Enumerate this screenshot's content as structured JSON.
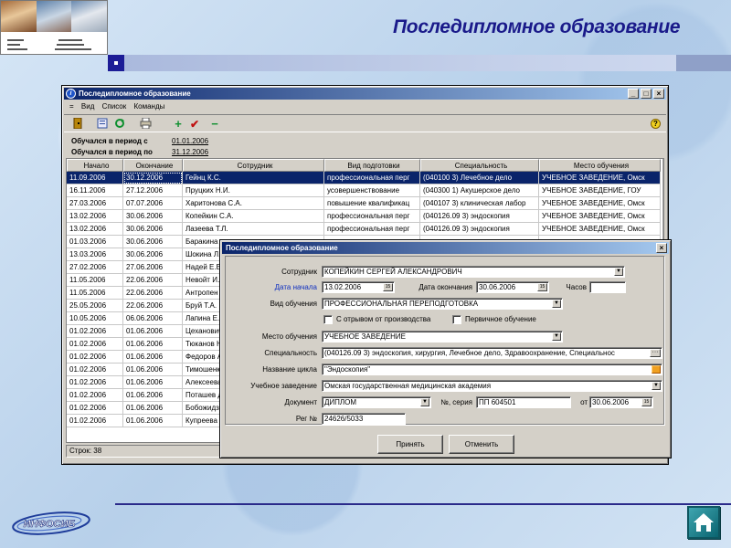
{
  "slide": {
    "title": "Последипломное образование",
    "logo_caption": "\n\n\n\n\n\n\n\n",
    "footer_logo": "ИНФОСИБ"
  },
  "main_window": {
    "title": "Последипломное образование",
    "menu": [
      "=",
      "Вид",
      "Список",
      "Команды"
    ],
    "filter_from_label": "Обучался в период с",
    "filter_from_value": "01.01.2006",
    "filter_to_label": "Обучался в период по",
    "filter_to_value": "31.12.2006",
    "columns": [
      "Начало",
      "Окончание",
      "Сотрудник",
      "Вид подготовки",
      "Специальность",
      "Место обучения"
    ],
    "rows": [
      [
        "11.09.2006",
        "30.12.2006",
        "Гейнц К.С.",
        "профессиональная перг",
        "(040100 3) Лечебное дело",
        "УЧЕБНОЕ ЗАВЕДЕНИЕ, Омск"
      ],
      [
        "16.11.2006",
        "27.12.2006",
        "Пруцких Н.И.",
        "усовершенствование",
        "(040300 1) Акушерское дело",
        "УЧЕБНОЕ ЗАВЕДЕНИЕ, ГОУ"
      ],
      [
        "27.03.2006",
        "07.07.2006",
        "Харитонова С.А.",
        "повышение квалификац",
        "(040107 3) клиническая лабор",
        "УЧЕБНОЕ ЗАВЕДЕНИЕ, Омск"
      ],
      [
        "13.02.2006",
        "30.06.2006",
        "Копейкин С.А.",
        "профессиональная перг",
        "(040126.09 3) эндоскопия",
        "УЧЕБНОЕ ЗАВЕДЕНИЕ, Омск"
      ],
      [
        "13.02.2006",
        "30.06.2006",
        "Лазеева Т.Л.",
        "профессиональная перг",
        "(040126.09 3) эндоскопия",
        "УЧЕБНОЕ ЗАВЕДЕНИЕ, Омск"
      ],
      [
        "01.03.2006",
        "30.06.2006",
        "Баракина",
        "",
        "",
        ""
      ],
      [
        "13.03.2006",
        "30.06.2006",
        "Шокина Л.",
        "",
        "",
        ""
      ],
      [
        "27.02.2006",
        "27.06.2006",
        "Надей Е.В.",
        "",
        "",
        ""
      ],
      [
        "11.05.2006",
        "22.06.2006",
        "Невойт И.",
        "",
        "",
        ""
      ],
      [
        "11.05.2006",
        "22.06.2006",
        "Антропен",
        "",
        "",
        ""
      ],
      [
        "25.05.2006",
        "22.06.2006",
        "Бруй Т.А.",
        "",
        "",
        ""
      ],
      [
        "10.05.2006",
        "06.06.2006",
        "Лапина Е.",
        "",
        "",
        ""
      ],
      [
        "01.02.2006",
        "01.06.2006",
        "Цеханович",
        "",
        "",
        ""
      ],
      [
        "01.02.2006",
        "01.06.2006",
        "Тюканов Н",
        "",
        "",
        ""
      ],
      [
        "01.02.2006",
        "01.06.2006",
        "Федоров А",
        "",
        "",
        ""
      ],
      [
        "01.02.2006",
        "01.06.2006",
        "Тимошенк",
        "",
        "",
        ""
      ],
      [
        "01.02.2006",
        "01.06.2006",
        "Алексеева",
        "",
        "",
        ""
      ],
      [
        "01.02.2006",
        "01.06.2006",
        "Поташев Д",
        "",
        "",
        ""
      ],
      [
        "01.02.2006",
        "01.06.2006",
        "Бобожидзе",
        "",
        "",
        ""
      ],
      [
        "01.02.2006",
        "01.06.2006",
        "Купреева А",
        "",
        "",
        ""
      ]
    ],
    "status": "Строк: 38",
    "help_icon": "question-icon"
  },
  "dialog": {
    "title": "Последипломное образование",
    "employee_label": "Сотрудник",
    "employee_value": "КОПЕЙКИН СЕРГЕЙ АЛЕКСАНДРОВИЧ",
    "start_label": "Дата начала",
    "start_value": "13.02.2006",
    "end_label": "Дата окончания",
    "end_value": "30.06.2006",
    "hours_label": "Часов",
    "hours_value": "",
    "training_label": "Вид обучения",
    "training_value": "ПРОФЕССИОНАЛЬНАЯ ПЕРЕПОДГОТОВКА",
    "check1_label": "С отрывом от производства",
    "check2_label": "Первичное обучение",
    "place_label": "Место обучения",
    "place_value": "УЧЕБНОЕ ЗАВЕДЕНИЕ",
    "specialty_label": "Специальность",
    "specialty_value": "(040126.09 3) эндоскопия, хирургия, Лечебное дело, Здравоохранение, Специальнос",
    "cycle_label": "Название цикла",
    "cycle_value": "\"Эндоскопия\"",
    "institution_label": "Учебное заведение",
    "institution_value": "Омская государственная медицинская академия",
    "doc_label": "Документ",
    "doc_value": "ДИПЛОМ",
    "series_label": "№, серия",
    "series_value": "ПП 604501",
    "from_label": "от",
    "from_value": "30.06.2006",
    "reg_label": "Рег №",
    "reg_value": "24626/5033",
    "ok_label": "Принять",
    "cancel_label": "Отменить"
  },
  "colors": {
    "title": "#1a1a8a",
    "selection": "#0a246a",
    "titlebar": "#0a246a",
    "accent_square": "#1c1c96"
  }
}
